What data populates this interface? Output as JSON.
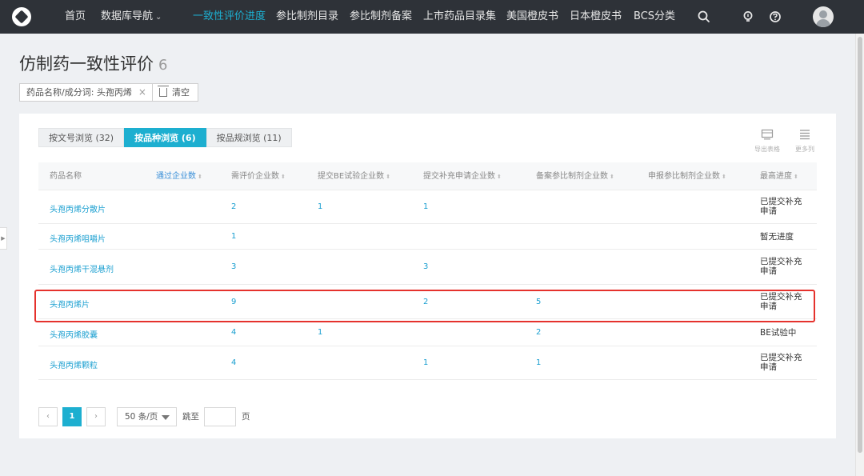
{
  "nav": {
    "items": [
      "首页",
      "数据库导航",
      "一致性评价进度",
      "参比制剂目录",
      "参比制剂备案",
      "上市药品目录集",
      "美国橙皮书",
      "日本橙皮书",
      "BCS分类"
    ],
    "active_index": 2,
    "icons": [
      "search-icon",
      "lightbulb-icon",
      "help-icon",
      "user-avatar"
    ]
  },
  "page": {
    "title": "仿制药一致性评价",
    "count": "6"
  },
  "filter": {
    "tag": "药品名称/成分词: 头孢丙烯",
    "close": "×",
    "clear_label": "清空"
  },
  "tabs": [
    "按文号浏览 (32)",
    "按品种浏览 (6)",
    "按品规浏览 (11)"
  ],
  "active_tab": 1,
  "tools": {
    "export": "导出表格",
    "more_columns": "更多列"
  },
  "table": {
    "headers": [
      "药品名称",
      "通过企业数",
      "需评价企业数",
      "提交BE试验企业数",
      "提交补充申请企业数",
      "备案参比制剂企业数",
      "申报参比制剂企业数",
      "最高进度"
    ],
    "rows": [
      {
        "name": "头孢丙烯分散片",
        "passed": "",
        "to_evaluate": "2",
        "be": "1",
        "supplement": "1",
        "ref_filed": "",
        "ref_applied": "",
        "progress": "已提交补充申请"
      },
      {
        "name": "头孢丙烯咀嚼片",
        "passed": "",
        "to_evaluate": "1",
        "be": "",
        "supplement": "",
        "ref_filed": "",
        "ref_applied": "",
        "progress": "暂无进度"
      },
      {
        "name": "头孢丙烯干混悬剂",
        "passed": "",
        "to_evaluate": "3",
        "be": "",
        "supplement": "3",
        "ref_filed": "",
        "ref_applied": "",
        "progress": "已提交补充申请"
      },
      {
        "name": "头孢丙烯片",
        "passed": "",
        "to_evaluate": "9",
        "be": "",
        "supplement": "2",
        "ref_filed": "5",
        "ref_applied": "",
        "progress": "已提交补充申请"
      },
      {
        "name": "头孢丙烯胶囊",
        "passed": "",
        "to_evaluate": "4",
        "be": "1",
        "supplement": "",
        "ref_filed": "2",
        "ref_applied": "",
        "progress": "BE试验中"
      },
      {
        "name": "头孢丙烯颗粒",
        "passed": "",
        "to_evaluate": "4",
        "be": "",
        "supplement": "1",
        "ref_filed": "1",
        "ref_applied": "",
        "progress": "已提交补充申请"
      }
    ],
    "highlighted_row": 3,
    "highlight_color": "#e5322d"
  },
  "pagination": {
    "prev": "‹",
    "current_page": "1",
    "next": "›",
    "page_size": "50 条/页",
    "jump_label": "跳至",
    "jump_value": "",
    "page_suffix": "页"
  },
  "colors": {
    "accent": "#1dafd0",
    "nav_bg": "#2e3238",
    "link": "#1a9fd0"
  }
}
